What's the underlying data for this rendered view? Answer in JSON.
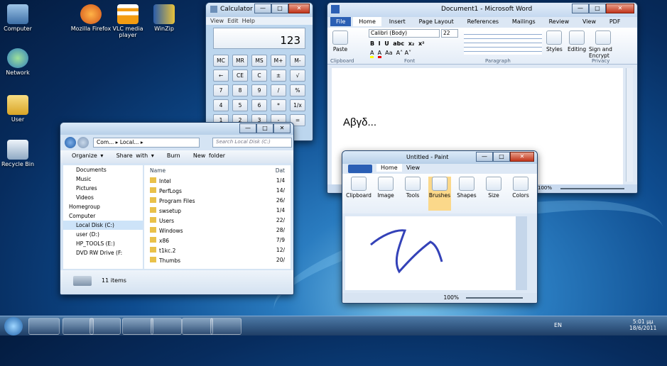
{
  "desktop_icons": [
    {
      "label": "Computer"
    },
    {
      "label": "Mozilla Firefox"
    },
    {
      "label": "VLC media player"
    },
    {
      "label": "WinZip"
    },
    {
      "label": "Network"
    },
    {
      "label": "User"
    },
    {
      "label": "Recycle Bin"
    }
  ],
  "calculator": {
    "title": "Calculator",
    "menu": [
      "View",
      "Edit",
      "Help"
    ],
    "display": "123",
    "rows": [
      [
        "MC",
        "MR",
        "MS",
        "M+",
        "M-"
      ],
      [
        "←",
        "CE",
        "C",
        "±",
        "√"
      ],
      [
        "7",
        "8",
        "9",
        "/",
        "%"
      ],
      [
        "4",
        "5",
        "6",
        "*",
        "1/x"
      ],
      [
        "1",
        "2",
        "3",
        "-",
        "="
      ]
    ]
  },
  "word": {
    "title": "Document1 - Microsoft Word",
    "tabs": [
      "File",
      "Home",
      "Insert",
      "Page Layout",
      "References",
      "Mailings",
      "Review",
      "View",
      "PDF"
    ],
    "font": "Calibri (Body)",
    "size": "22",
    "groups": [
      "Clipboard",
      "Font",
      "Paragraph",
      "Styles",
      "Editing",
      "Sign and Encrypt",
      "Privacy"
    ],
    "paste": "Paste",
    "styles": "Styles",
    "editing": "Editing",
    "sign": "Sign and Encrypt",
    "body_text": "Αβγδ...",
    "zoom": "100%"
  },
  "explorer": {
    "crumb": [
      "Com...",
      "Local...",
      "Search Local Disk (C:)"
    ],
    "toolbar": [
      "Organize ▾",
      "Share with ▾",
      "Burn",
      "New folder"
    ],
    "nav": [
      "Documents",
      "Music",
      "Pictures",
      "Videos",
      "Homegroup",
      "Computer",
      "Local Disk (C:)",
      "user (D:)",
      "HP_TOOLS (E:)",
      "DVD RW Drive (F:"
    ],
    "col_name": "Name",
    "col_date": "Dat",
    "files": [
      {
        "name": "Intel",
        "date": "1/4"
      },
      {
        "name": "PerfLogs",
        "date": "14/"
      },
      {
        "name": "Program Files",
        "date": "26/"
      },
      {
        "name": "swsetup",
        "date": "1/4"
      },
      {
        "name": "Users",
        "date": "22/"
      },
      {
        "name": "Windows",
        "date": "28/"
      },
      {
        "name": "x86",
        "date": "7/9"
      },
      {
        "name": "t1kc.2",
        "date": "12/"
      },
      {
        "name": "Thumbs",
        "date": "20/"
      }
    ],
    "status": "11 items"
  },
  "paint": {
    "title": "Untitled - Paint",
    "tabs": [
      "Home",
      "View"
    ],
    "tools": [
      "Clipboard",
      "Image",
      "Tools",
      "Brushes",
      "Shapes",
      "Size",
      "Colors"
    ],
    "zoom": "100%"
  },
  "tray": {
    "lang": "EN",
    "time": "5:01 μμ",
    "date": "18/6/2011"
  }
}
